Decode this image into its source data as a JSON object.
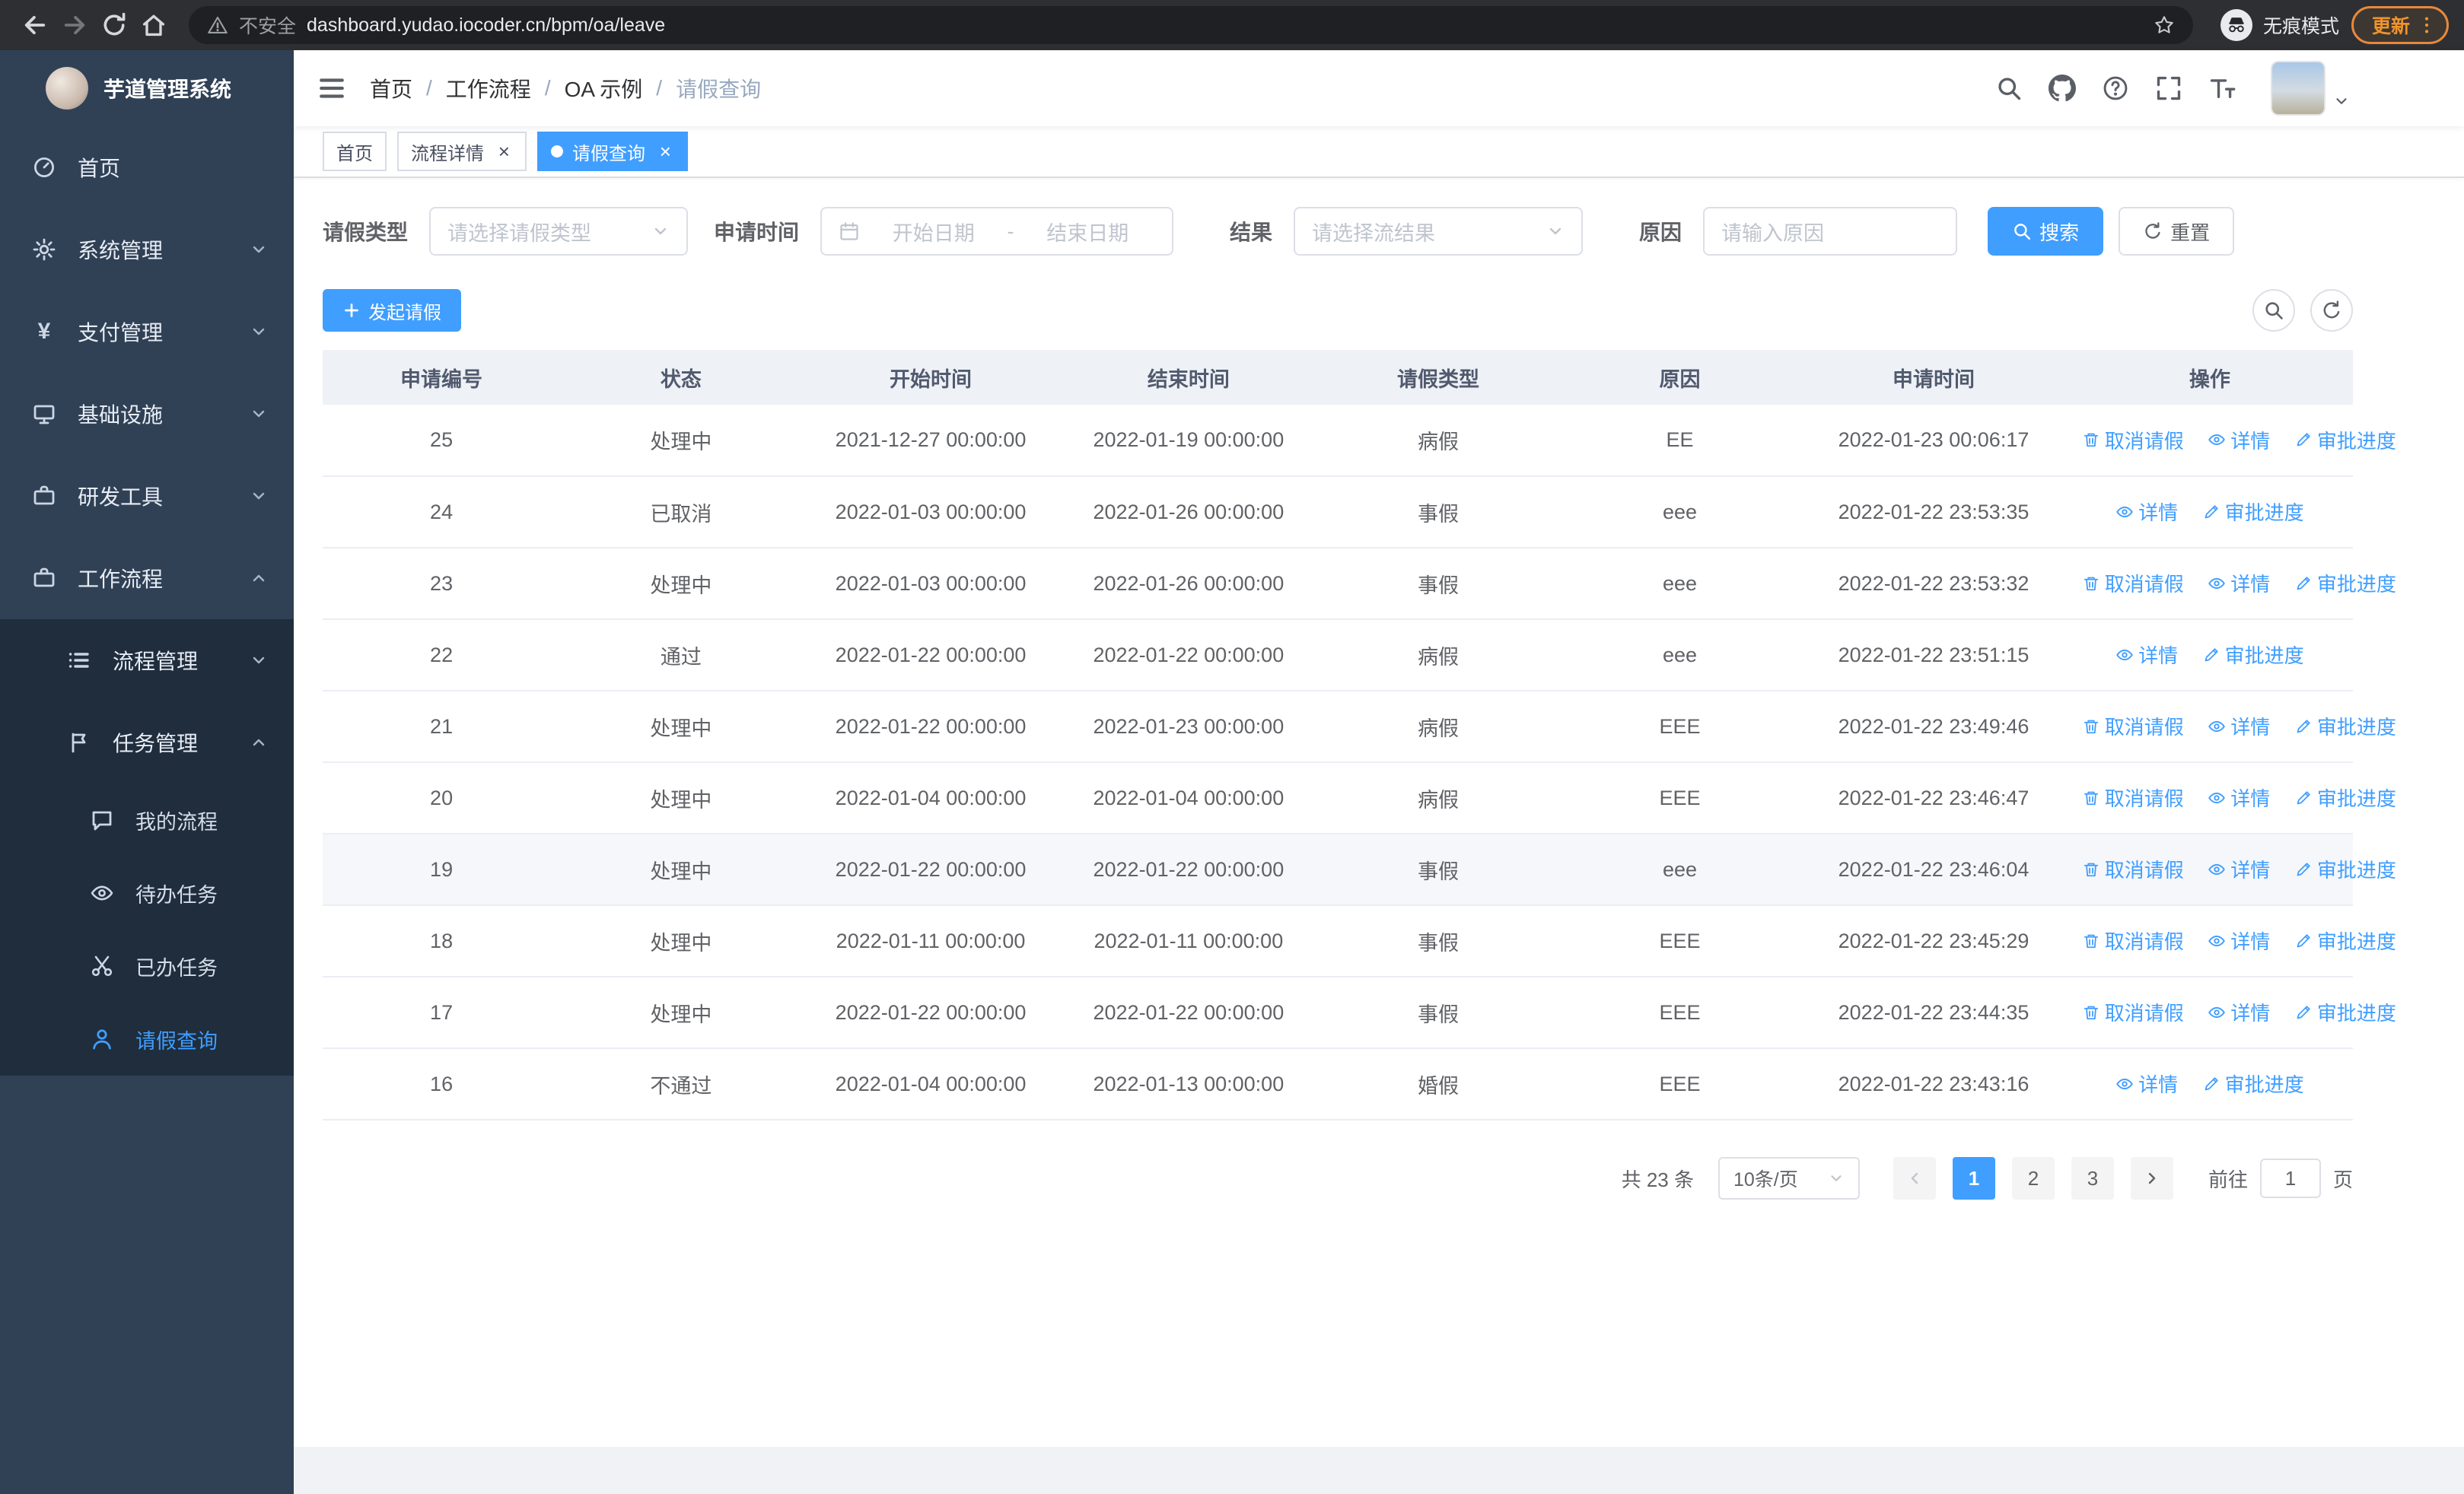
{
  "browser": {
    "security_label": "不安全",
    "url": "dashboard.yudao.iocoder.cn/bpm/oa/leave",
    "incognito_label": "无痕模式",
    "update_label": "更新"
  },
  "sidebar": {
    "logo_title": "芋道管理系统",
    "items": [
      {
        "label": "首页",
        "icon": "dashboard",
        "level": 1
      },
      {
        "label": "系统管理",
        "icon": "gear",
        "level": 1,
        "chevron": "chevron-down"
      },
      {
        "label": "支付管理",
        "icon": "yen",
        "level": 1,
        "chevron": "chevron-down"
      },
      {
        "label": "基础设施",
        "icon": "monitor",
        "level": 1,
        "chevron": "chevron-down"
      },
      {
        "label": "研发工具",
        "icon": "suitcase",
        "level": 1,
        "chevron": "chevron-down"
      },
      {
        "label": "工作流程",
        "icon": "suitcase",
        "level": 1,
        "chevron": "chevron-up"
      },
      {
        "label": "流程管理",
        "icon": "list",
        "level": 2,
        "in_submenu": true,
        "chevron": "chevron-down"
      },
      {
        "label": "任务管理",
        "icon": "flag",
        "level": 2,
        "in_submenu": true,
        "chevron": "chevron-up"
      },
      {
        "label": "我的流程",
        "icon": "chat",
        "level": 3,
        "in_submenu": true
      },
      {
        "label": "待办任务",
        "icon": "eye",
        "level": 3,
        "in_submenu": true
      },
      {
        "label": "已办任务",
        "icon": "scissors",
        "level": 3,
        "in_submenu": true
      },
      {
        "label": "请假查询",
        "icon": "user",
        "level": 3,
        "in_submenu": true,
        "active": true
      }
    ]
  },
  "header": {
    "breadcrumb_separator": "/",
    "breadcrumbs": [
      {
        "label": "首页",
        "sep": true
      },
      {
        "label": "工作流程",
        "sep": true
      },
      {
        "label": "OA 示例",
        "sep": true
      },
      {
        "label": "请假查询",
        "current": true
      }
    ]
  },
  "tabs": [
    {
      "label": "首页"
    },
    {
      "label": "流程详情",
      "closable": true
    },
    {
      "label": "请假查询",
      "closable": true,
      "active": true,
      "dot": true
    }
  ],
  "filters": {
    "leave_type_label": "请假类型",
    "leave_type_placeholder": "请选择请假类型",
    "apply_time_label": "申请时间",
    "start_date_placeholder": "开始日期",
    "range_separator": "-",
    "end_date_placeholder": "结束日期",
    "result_label": "结果",
    "result_placeholder": "请选择流结果",
    "reason_label": "原因",
    "reason_placeholder": "请输入原因",
    "search_label": "搜索",
    "reset_label": "重置"
  },
  "toolbar": {
    "create_label": "发起请假"
  },
  "table": {
    "columns": [
      "申请编号",
      "状态",
      "开始时间",
      "结束时间",
      "请假类型",
      "原因",
      "申请时间",
      "操作"
    ],
    "rows": [
      {
        "id": "25",
        "status": "处理中",
        "start": "2021-12-27 00:00:00",
        "end": "2022-01-19 00:00:00",
        "type": "病假",
        "reason": "EE",
        "applied": "2022-01-23 00:06:17",
        "can_cancel": true
      },
      {
        "id": "24",
        "status": "已取消",
        "start": "2022-01-03 00:00:00",
        "end": "2022-01-26 00:00:00",
        "type": "事假",
        "reason": "eee",
        "applied": "2022-01-22 23:53:35"
      },
      {
        "id": "23",
        "status": "处理中",
        "start": "2022-01-03 00:00:00",
        "end": "2022-01-26 00:00:00",
        "type": "事假",
        "reason": "eee",
        "applied": "2022-01-22 23:53:32",
        "can_cancel": true
      },
      {
        "id": "22",
        "status": "通过",
        "start": "2022-01-22 00:00:00",
        "end": "2022-01-22 00:00:00",
        "type": "病假",
        "reason": "eee",
        "applied": "2022-01-22 23:51:15"
      },
      {
        "id": "21",
        "status": "处理中",
        "start": "2022-01-22 00:00:00",
        "end": "2022-01-23 00:00:00",
        "type": "病假",
        "reason": "EEE",
        "applied": "2022-01-22 23:49:46",
        "can_cancel": true
      },
      {
        "id": "20",
        "status": "处理中",
        "start": "2022-01-04 00:00:00",
        "end": "2022-01-04 00:00:00",
        "type": "病假",
        "reason": "EEE",
        "applied": "2022-01-22 23:46:47",
        "can_cancel": true
      },
      {
        "id": "19",
        "status": "处理中",
        "start": "2022-01-22 00:00:00",
        "end": "2022-01-22 00:00:00",
        "type": "事假",
        "reason": "eee",
        "applied": "2022-01-22 23:46:04",
        "can_cancel": true,
        "hover": true
      },
      {
        "id": "18",
        "status": "处理中",
        "start": "2022-01-11 00:00:00",
        "end": "2022-01-11 00:00:00",
        "type": "事假",
        "reason": "EEE",
        "applied": "2022-01-22 23:45:29",
        "can_cancel": true
      },
      {
        "id": "17",
        "status": "处理中",
        "start": "2022-01-22 00:00:00",
        "end": "2022-01-22 00:00:00",
        "type": "事假",
        "reason": "EEE",
        "applied": "2022-01-22 23:44:35",
        "can_cancel": true
      },
      {
        "id": "16",
        "status": "不通过",
        "start": "2022-01-04 00:00:00",
        "end": "2022-01-13 00:00:00",
        "type": "婚假",
        "reason": "EEE",
        "applied": "2022-01-22 23:43:16"
      }
    ]
  },
  "actions": {
    "cancel": "取消请假",
    "detail": "详情",
    "progress": "审批进度"
  },
  "pagination": {
    "total_text": "共 23 条",
    "page_size": "10条/页",
    "pages": [
      {
        "label": "1",
        "active": true
      },
      {
        "label": "2"
      },
      {
        "label": "3"
      }
    ],
    "goto_prefix": "前往",
    "goto_value": "1",
    "goto_suffix": "页"
  }
}
